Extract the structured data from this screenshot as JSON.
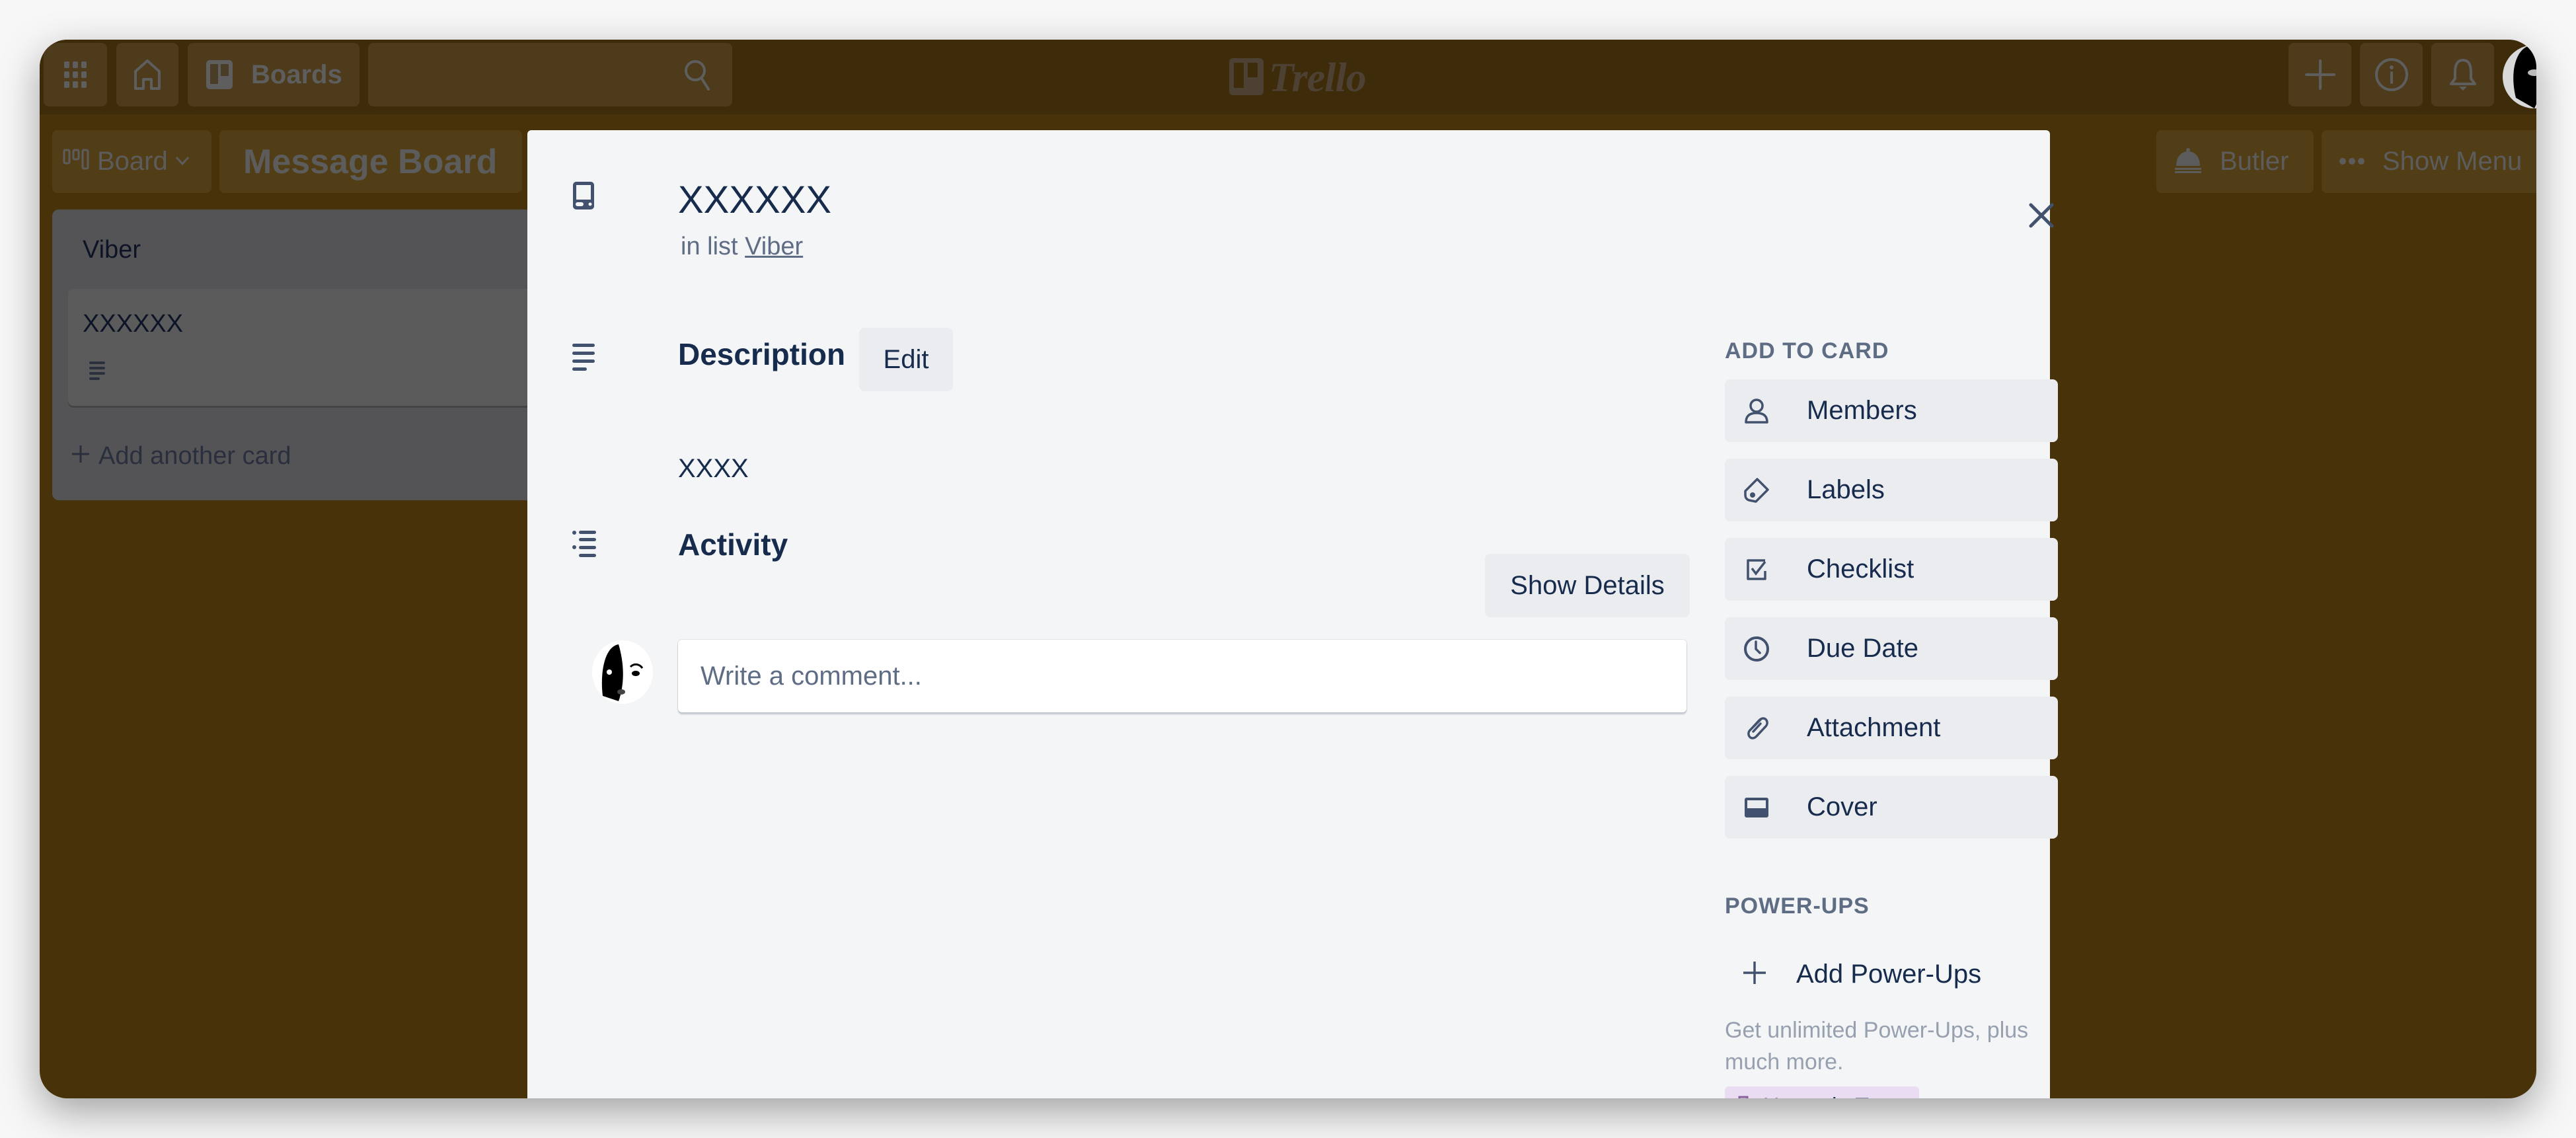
{
  "topnav": {
    "apps_icon": "grid-icon",
    "home_icon": "home-icon",
    "boards_label": "Boards",
    "search_placeholder": "",
    "logo_text": "Trello",
    "right_icons": [
      "plus-icon",
      "info-icon",
      "bell-icon"
    ],
    "avatar": "user-avatar"
  },
  "board_header": {
    "view_label": "Board",
    "board_title": "Message Board",
    "butler_label": "Butler",
    "menu_label": "Show Menu"
  },
  "list": {
    "title": "Viber",
    "cards": [
      {
        "title": "XXXXXX",
        "has_description": true
      }
    ],
    "add_card_label": "Add another card"
  },
  "card_modal": {
    "title": "XXXXXX",
    "in_list_prefix": "in list",
    "list_name": "Viber",
    "description_heading": "Description",
    "edit_label": "Edit",
    "description_text": "XXXX",
    "activity_heading": "Activity",
    "show_details_label": "Show Details",
    "comment_placeholder": "Write a comment..."
  },
  "sidebar": {
    "add_to_card_heading": "ADD TO CARD",
    "actions": [
      {
        "label": "Members",
        "icon": "person-icon"
      },
      {
        "label": "Labels",
        "icon": "tag-icon"
      },
      {
        "label": "Checklist",
        "icon": "checkbox-icon"
      },
      {
        "label": "Due Date",
        "icon": "clock-icon"
      },
      {
        "label": "Attachment",
        "icon": "paperclip-icon"
      },
      {
        "label": "Cover",
        "icon": "cover-icon"
      }
    ],
    "powerups_heading": "POWER-UPS",
    "add_powerups_label": "Add Power-Ups",
    "powerups_description": "Get unlimited Power-Ups, plus much more.",
    "upgrade_label": "Upgrade Team"
  },
  "colors": {
    "nav_bg": "#3e2b09",
    "board_bg": "#473209",
    "modal_bg": "#f4f5f7",
    "button_bg": "#ebecf0",
    "text_primary": "#172b4d",
    "text_secondary": "#5e6c84",
    "upgrade_bg": "#eadcf3",
    "upgrade_icon": "#89609e"
  }
}
